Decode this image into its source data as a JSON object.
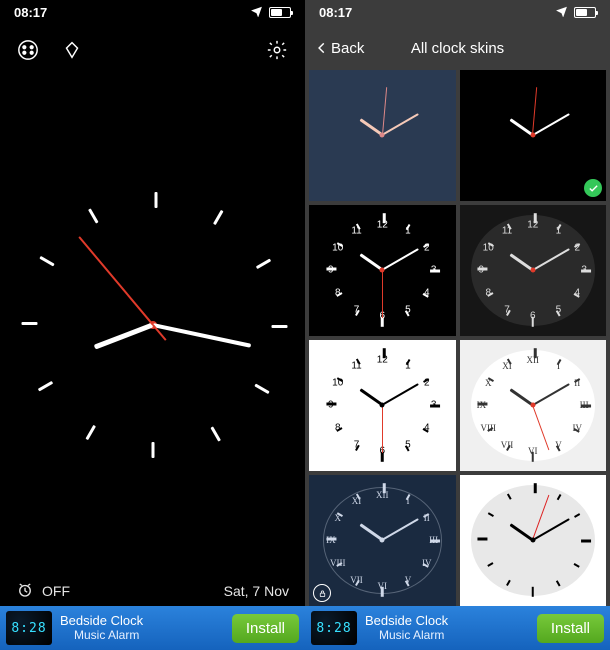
{
  "status": {
    "time": "08:17"
  },
  "left": {
    "alarm_label": "OFF",
    "date": "Sat, 7 Nov"
  },
  "right": {
    "back_label": "Back",
    "title": "All clock skins"
  },
  "ad": {
    "thumb_time": "8:28",
    "line1": "Bedside Clock",
    "line2": "Music Alarm",
    "button": "Install"
  },
  "skins": [
    {
      "id": "minimal-navy",
      "bg": "navy",
      "selected": false,
      "locked": false
    },
    {
      "id": "minimal-black",
      "bg": "black",
      "selected": true,
      "locked": false
    },
    {
      "id": "numbers-black",
      "bg": "black",
      "selected": false,
      "locked": false
    },
    {
      "id": "numbers-dark",
      "bg": "dark2",
      "selected": false,
      "locked": false
    },
    {
      "id": "white-arabic",
      "bg": "white",
      "selected": false,
      "locked": true
    },
    {
      "id": "white-roman",
      "bg": "lgrey",
      "selected": false,
      "locked": false
    },
    {
      "id": "navy-roman",
      "bg": "navy2",
      "selected": false,
      "locked": true
    },
    {
      "id": "grey-bold",
      "bg": "white",
      "selected": false,
      "locked": false
    }
  ]
}
